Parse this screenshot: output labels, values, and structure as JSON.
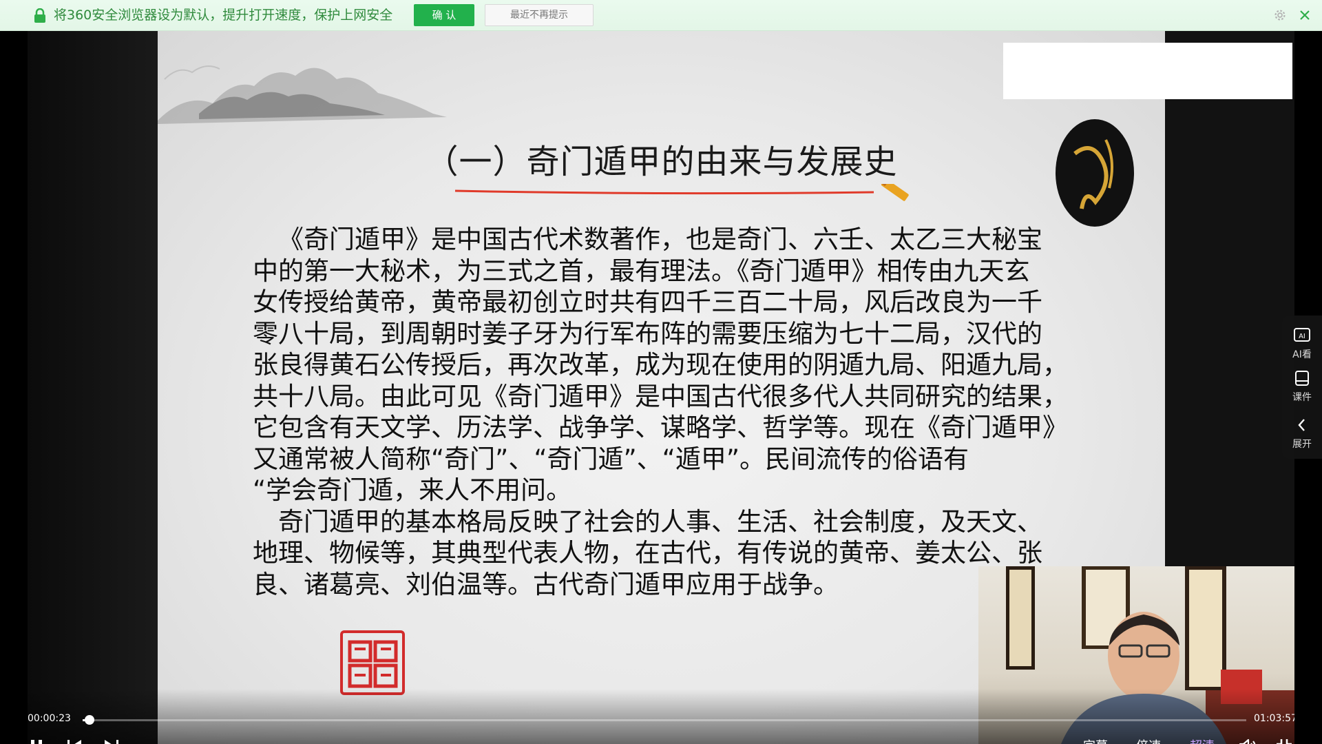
{
  "notification": {
    "message": "将360安全浏览器设为默认，提升打开速度，保护上网安全",
    "confirm_label": "确 认",
    "dismiss_label": "最近不再提示"
  },
  "slide": {
    "title": "（一）奇门遁甲的由来与发展史",
    "paragraph1": "《奇门遁甲》是中国古代术数著作，也是奇门、六壬、太乙三大秘宝\n中的第一大秘术，为三式之首，最有理法。《奇门遁甲》相传由九天玄\n女传授给黄帝，黄帝最初创立时共有四千三百二十局，风后改良为一千\n零八十局，到周朝时姜子牙为行军布阵的需要压缩为七十二局，汉代的\n张良得黄石公传授后，再次改革，成为现在使用的阴遁九局、阳遁九局，\n共十八局。由此可见《奇门遁甲》是中国古代很多代人共同研究的结果，\n它包含有天文学、历法学、战争学、谋略学、哲学等。现在《奇门遁甲》\n又通常被人简称“奇门”、“奇门遁”、“遁甲”。民间流传的俗语有\n“学会奇门遁，来人不用问。",
    "paragraph2": "奇门遁甲的基本格局反映了社会的人事、生活、社会制度，及天文、\n地理、物候等，其典型代表人物，在古代，有传说的黄帝、姜太公、张\n良、诸葛亮、刘伯温等。古代奇门遁甲应用于战争。"
  },
  "side_panel": {
    "items": [
      {
        "label": "AI看",
        "icon": "ai-watch-icon"
      },
      {
        "label": "课件",
        "icon": "courseware-icon"
      },
      {
        "label": "展开",
        "icon": "chevron-left-icon"
      }
    ]
  },
  "player": {
    "current_time": "00:00:23",
    "total_time": "01:03:57",
    "progress_fraction": 0.006,
    "subtitles_label": "字幕",
    "speed_label": "倍速",
    "quality_label": "超清"
  },
  "colors": {
    "accent_green": "#22b14c",
    "active_quality": "#c8a2ff",
    "title_underline": "#e03a2a"
  }
}
